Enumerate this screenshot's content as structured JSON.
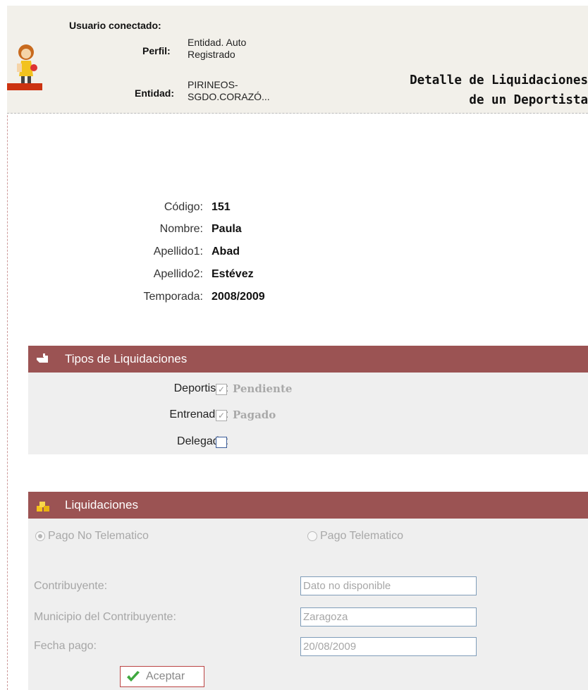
{
  "header": {
    "user_label": "Usuario conectado:",
    "perfil_label": "Perfil:",
    "perfil_value_1": "Entidad. Auto",
    "perfil_value_2": "Registrado",
    "entidad_label": "Entidad:",
    "entidad_value_1": "PIRINEOS-",
    "entidad_value_2": "SGDO.CORAZÓ...",
    "title_line1": "Detalle de Liquidaciones",
    "title_line2": "de un Deportista"
  },
  "athlete": {
    "codigo_label": "Código:",
    "codigo_value": "151",
    "nombre_label": "Nombre:",
    "nombre_value": "Paula",
    "apellido1_label": "Apellido1:",
    "apellido1_value": "Abad",
    "apellido2_label": "Apellido2:",
    "apellido2_value": "Estévez",
    "temporada_label": "Temporada:",
    "temporada_value": "2008/2009"
  },
  "tipos": {
    "title": "Tipos de Liquidaciones",
    "deportista_label": "Deportista:",
    "deportista_state": "Pendiente",
    "entrenador_label": "Entrenador:",
    "entrenador_state": "Pagado",
    "delegado_label": "Delegado:"
  },
  "liquidaciones": {
    "title": "Liquidaciones",
    "radio_no_telematico": "Pago No Telematico",
    "radio_telematico": "Pago Telematico",
    "contribuyente_label": "Contribuyente:",
    "contribuyente_value": "Dato no disponible",
    "municipio_label": "Municipio del Contribuyente:",
    "municipio_value": "Zaragoza",
    "fecha_label": "Fecha pago:",
    "fecha_value": "20/08/2009",
    "accept_label": "Aceptar"
  },
  "colors": {
    "section_bar": "#9b5353",
    "section_body": "#efefef",
    "header_bg": "#f2f0ea"
  }
}
